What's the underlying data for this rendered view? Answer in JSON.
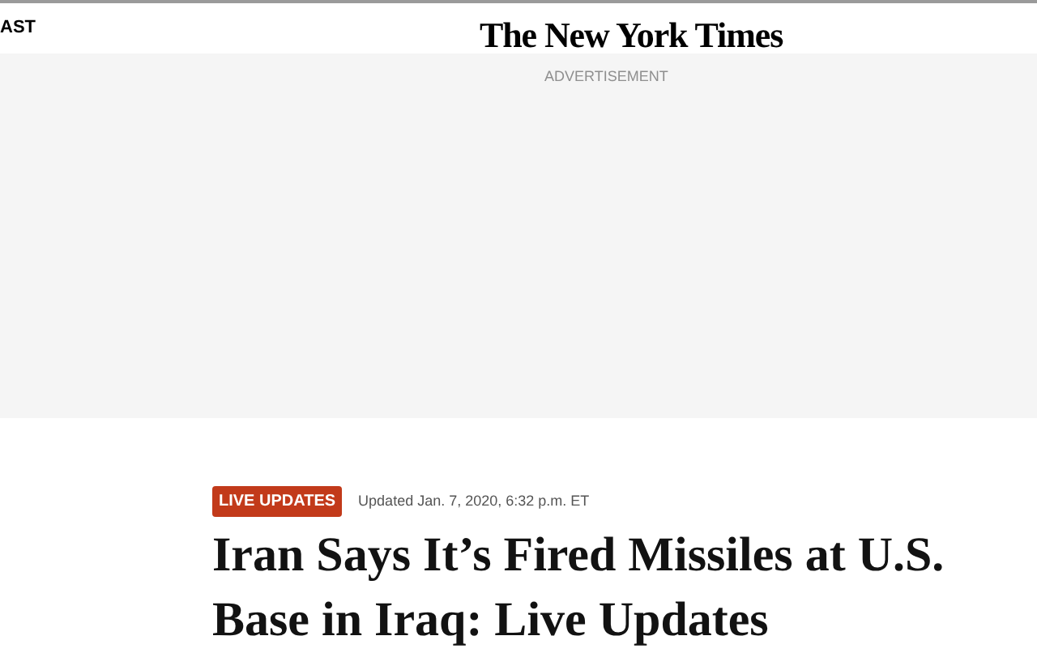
{
  "header": {
    "section_label": "AST",
    "logo": "The New York Times"
  },
  "advertisement": {
    "label": "ADVERTISEMENT"
  },
  "article": {
    "badge": "LIVE UPDATES",
    "timestamp": "Updated Jan. 7, 2020, 6:32 p.m. ET",
    "headline": "Iran Says It’s Fired Missiles at U.S. Base in Iraq: Live Updates"
  }
}
